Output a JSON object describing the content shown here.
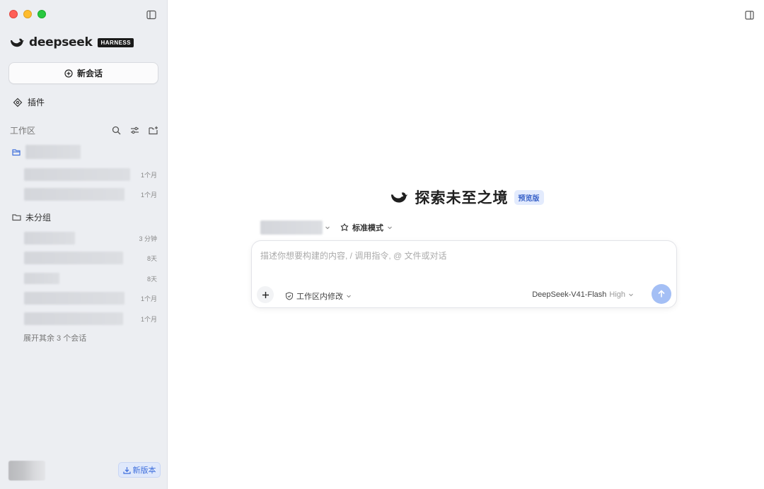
{
  "window": {
    "traffic_lights": [
      "close",
      "minimize",
      "maximize"
    ]
  },
  "brand": {
    "name": "deepseek",
    "badge": "HARNESS"
  },
  "sidebar": {
    "new_chat_label": "新会话",
    "plugins_label": "插件",
    "workspace_title": "工作区",
    "folders": [
      {
        "name": "",
        "conversations": [
          {
            "time": "1个月"
          },
          {
            "time": "1个月"
          }
        ]
      },
      {
        "name": "未分组",
        "conversations": [
          {
            "time": "3 分钟"
          },
          {
            "time": "8天"
          },
          {
            "time": "8天"
          },
          {
            "time": "1个月"
          },
          {
            "time": "1个月"
          }
        ]
      }
    ],
    "expand_more_label": "展开其余 3 个会话",
    "update_label": "新版本"
  },
  "main": {
    "hero_title": "探索未至之境",
    "hero_badge": "预览版",
    "mode_label": "标准模式",
    "composer": {
      "placeholder": "描述你想要构建的内容, / 调用指令, @ 文件或对话",
      "edit_scope_label": "工作区内修改",
      "model_name": "DeepSeek-V41-Flash",
      "model_level": "High"
    }
  },
  "colors": {
    "sidebar_bg": "#eceef2",
    "accent": "#3f6fdc",
    "send_button": "#a4bff5",
    "badge_bg": "#e3ebfd"
  }
}
